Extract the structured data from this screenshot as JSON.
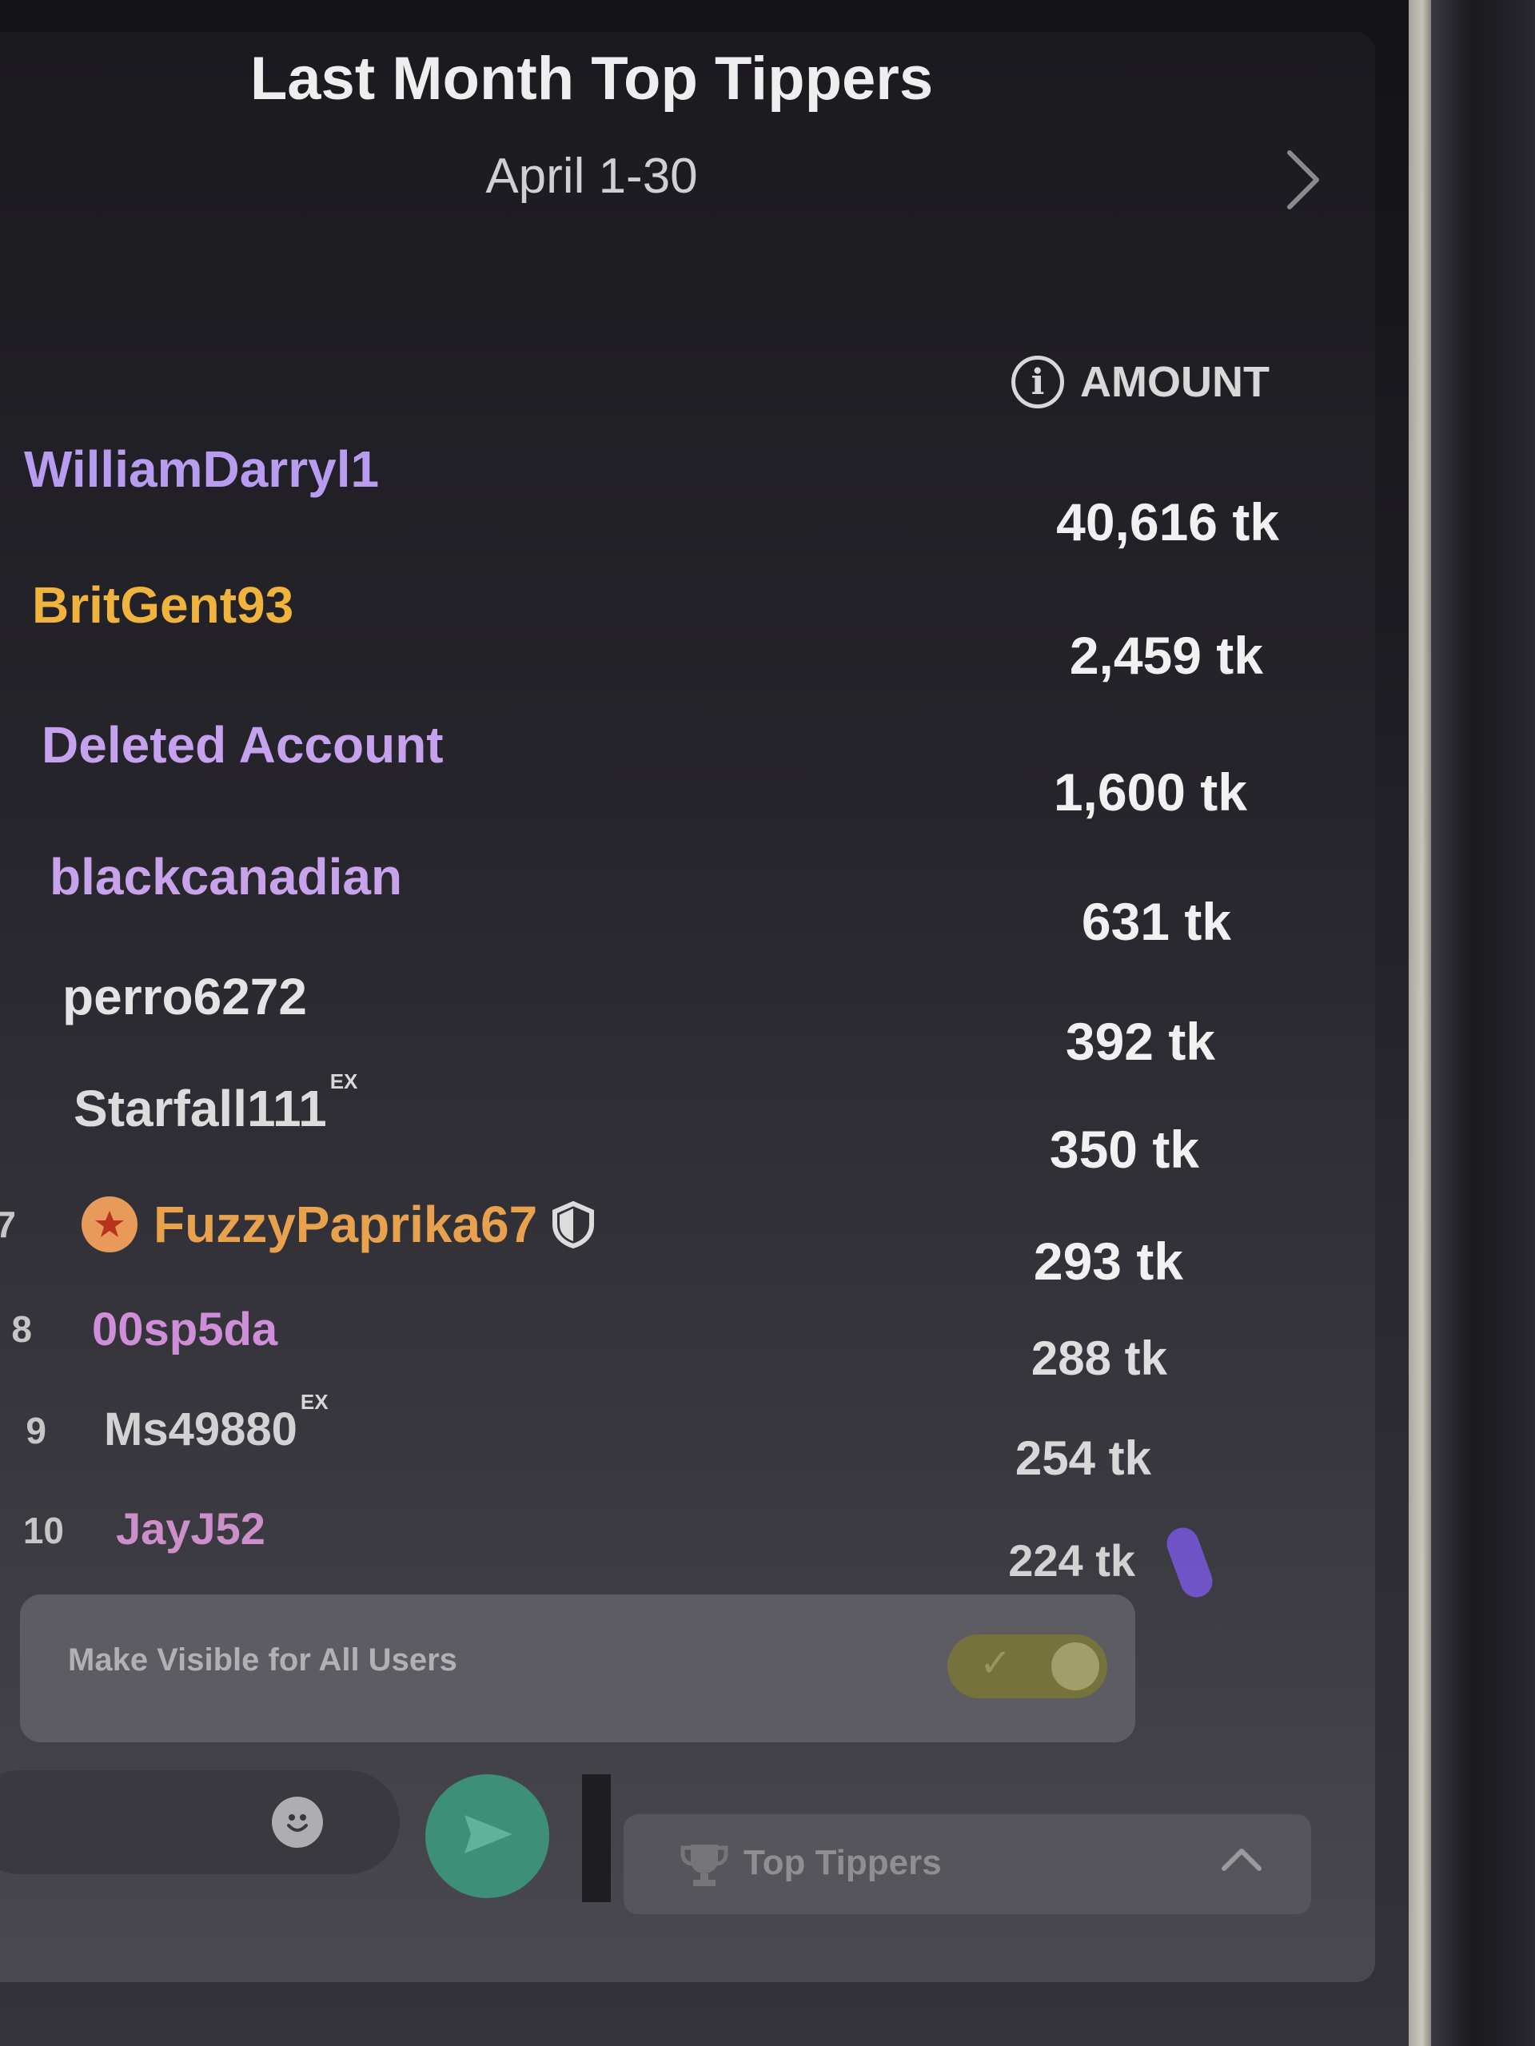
{
  "header": {
    "title": "Last Month Top Tippers",
    "subtitle": "April 1-30"
  },
  "table": {
    "amount_header": "AMOUNT",
    "info_glyph": "i",
    "rows": [
      {
        "rank": "",
        "name": "WilliamDarryl1",
        "amount": "40,616 tk",
        "name_color": "#b79cf0",
        "badge": ""
      },
      {
        "rank": "",
        "name": "BritGent93",
        "amount": "2,459 tk",
        "name_color": "#f0b43e",
        "badge": ""
      },
      {
        "rank": "",
        "name": "Deleted Account",
        "amount": "1,600 tk",
        "name_color": "#c6a2ee",
        "badge": ""
      },
      {
        "rank": "",
        "name": "blackcanadian",
        "amount": "631 tk",
        "name_color": "#c8a2ea",
        "badge": ""
      },
      {
        "rank": "",
        "name": "perro6272",
        "amount": "392 tk",
        "name_color": "#e4e4e4",
        "badge": ""
      },
      {
        "rank": "",
        "name": "Starfall111",
        "amount": "350 tk",
        "name_color": "#dcdcdc",
        "badge": "EX"
      },
      {
        "rank": "7",
        "name": "FuzzyPaprika67",
        "amount": "293 tk",
        "name_color": "#e8a24e",
        "badge": ""
      },
      {
        "rank": "8",
        "name": "00sp5da",
        "amount": "288 tk",
        "name_color": "#cf8fd8",
        "badge": ""
      },
      {
        "rank": "9",
        "name": "Ms49880",
        "amount": "254 tk",
        "name_color": "#d2d2d2",
        "badge": "EX"
      },
      {
        "rank": "10",
        "name": "JayJ52",
        "amount": "224 tk",
        "name_color": "#cd8fc9",
        "badge": ""
      }
    ]
  },
  "visibility": {
    "label": "Make Visible for All Users",
    "toggle_on": true,
    "check_glyph": "✓"
  },
  "footer": {
    "tab_label": "Top Tippers",
    "icons": [
      "chevron-right-icon",
      "info-icon",
      "star-icon",
      "shield-icon",
      "smiley-icon",
      "send-icon",
      "trophy-icon",
      "chevron-up-icon"
    ]
  },
  "colors": {
    "send_button": "#3d8f78",
    "toggle_track": "#76723c",
    "cursor": "#7a5ae8"
  }
}
